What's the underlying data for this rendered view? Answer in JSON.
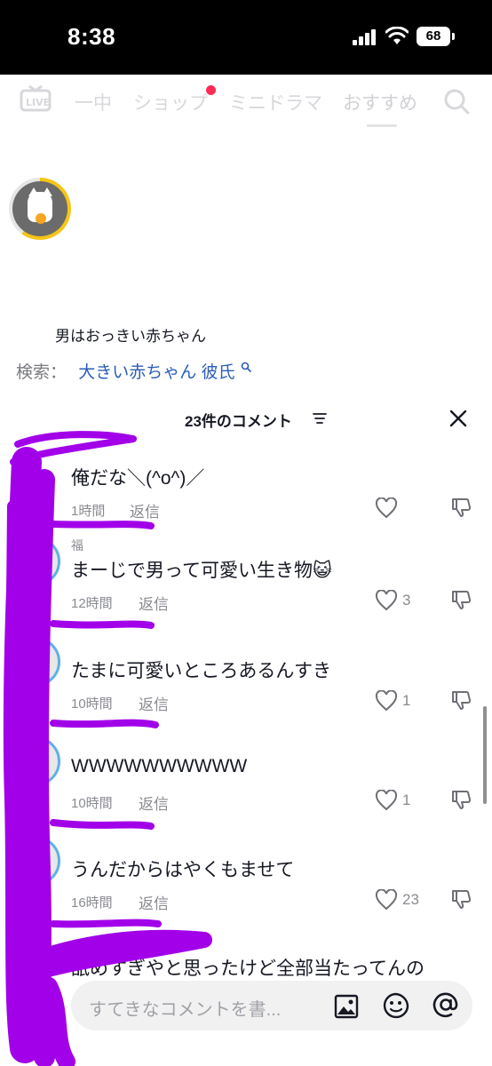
{
  "status": {
    "time": "8:38",
    "battery": "68"
  },
  "top_nav": {
    "tabs": [
      "一中",
      "ショップ",
      "ミニドラマ",
      "おすすめ"
    ]
  },
  "post": {
    "caption": "男はおっきい赤ちゃん",
    "search_label": "検索：",
    "search_query": "大きい赤ちゃん 彼氏"
  },
  "comments_panel": {
    "title": "23件のコメント",
    "comments": [
      {
        "name": "",
        "text": "俺だな＼(^o^)／",
        "time": "1時間",
        "reply": "返信",
        "likes": ""
      },
      {
        "name": "福",
        "text": "まーじで男って可愛い生き物😺",
        "time": "12時間",
        "reply": "返信",
        "likes": "3"
      },
      {
        "name": "",
        "text": "たまに可愛いところあるんすき",
        "time": "10時間",
        "reply": "返信",
        "likes": "1"
      },
      {
        "name": "",
        "text": "WWWWWWWWWW",
        "time": "10時間",
        "reply": "返信",
        "likes": "1"
      },
      {
        "name": "",
        "text": "うんだからはやくもませて",
        "time": "16時間",
        "reply": "返信",
        "likes": "23"
      }
    ],
    "partial_text": "舐めすぎやと思ったけど全部当たってんの"
  },
  "input": {
    "placeholder": "すてきなコメントを書..."
  },
  "colors": {
    "accent": "#fe2c55",
    "link": "#2b5db8",
    "scribble": "#a100e8"
  }
}
